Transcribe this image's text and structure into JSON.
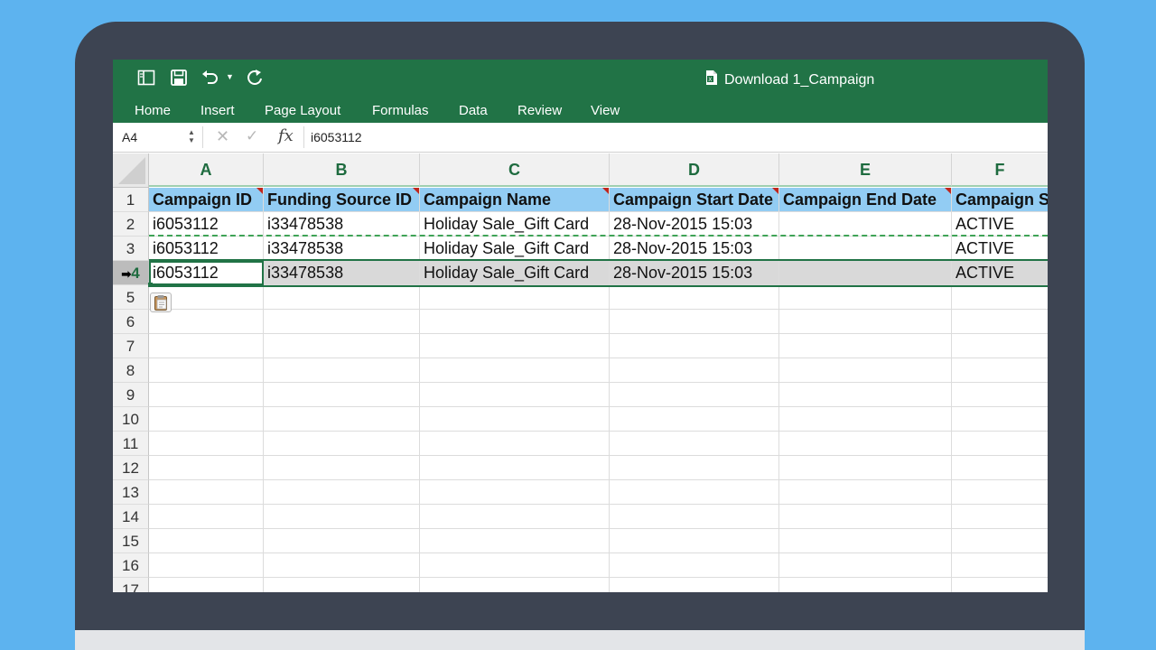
{
  "window": {
    "document_title": "Download 1_Campaign"
  },
  "ribbon": {
    "tabs": [
      "Home",
      "Insert",
      "Page Layout",
      "Formulas",
      "Data",
      "Review",
      "View"
    ]
  },
  "formula_bar": {
    "name_box": "A4",
    "fx_label": "fx",
    "value": "i6053112"
  },
  "grid": {
    "columns": [
      "A",
      "B",
      "C",
      "D",
      "E",
      "F"
    ],
    "row_numbers": [
      "1",
      "2",
      "3",
      "4",
      "5",
      "6",
      "7",
      "8",
      "9",
      "10",
      "11",
      "12",
      "13",
      "14",
      "15",
      "16",
      "17"
    ],
    "selected_row": "4",
    "header_row": [
      "Campaign ID",
      "Funding Source ID",
      "Campaign Name",
      "Campaign Start Date",
      "Campaign End Date",
      "Campaign St"
    ],
    "rows": [
      [
        "i6053112",
        "i33478538",
        "Holiday Sale_Gift Card",
        "28-Nov-2015 15:03",
        "",
        "ACTIVE"
      ],
      [
        "i6053112",
        "i33478538",
        "Holiday Sale_Gift Card",
        "28-Nov-2015 15:03",
        "",
        "ACTIVE"
      ],
      [
        "i6053112",
        "i33478538",
        "Holiday Sale_Gift Card",
        "28-Nov-2015 15:03",
        "",
        "ACTIVE"
      ]
    ]
  },
  "colors": {
    "ribbon_green": "#217346",
    "header_row_blue": "#92ccf3",
    "selection_gray": "#d9d9d9",
    "background_blue": "#5db3ef",
    "laptop_frame": "#3d4452"
  },
  "icons": {
    "sidebar": "sidebar-toggle-icon",
    "save": "save-icon",
    "undo": "undo-icon",
    "redo": "redo-icon",
    "excel_doc": "excel-document-icon",
    "paste_options": "paste-options-icon"
  }
}
